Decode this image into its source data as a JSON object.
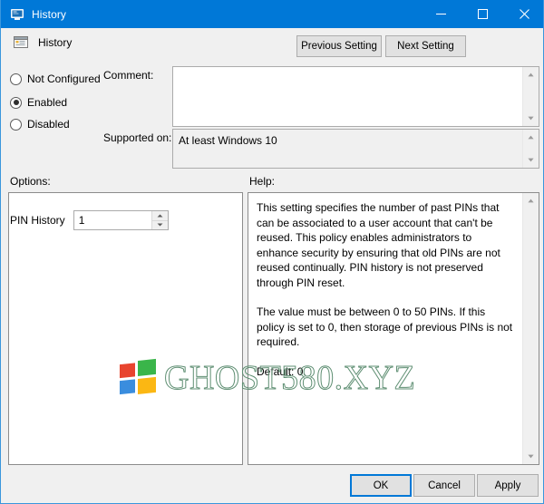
{
  "window": {
    "title": "History",
    "title_icon": "policy-setting-icon",
    "controls": {
      "minimize": "minimize-icon",
      "maximize": "maximize-icon",
      "close": "close-icon"
    }
  },
  "header": {
    "icon": "policy-setting-icon",
    "title": "History"
  },
  "nav": {
    "previous_label": "Previous Setting",
    "next_label": "Next Setting"
  },
  "state": {
    "options": [
      {
        "label": "Not Configured",
        "selected": false
      },
      {
        "label": "Enabled",
        "selected": true
      },
      {
        "label": "Disabled",
        "selected": false
      }
    ]
  },
  "comment": {
    "label": "Comment:",
    "value": "",
    "placeholder": ""
  },
  "supported": {
    "label": "Supported on:",
    "value": "At least Windows 10"
  },
  "options_panel": {
    "label": "Options:",
    "pin_history": {
      "label": "PIN History",
      "value": "1",
      "up_icon": "spinner-up-icon",
      "down_icon": "spinner-down-icon"
    }
  },
  "help_panel": {
    "label": "Help:",
    "paragraphs": [
      "This setting specifies the number of past PINs that can be associated to a user account that can't be reused. This policy enables administrators to enhance security by ensuring that old PINs are not reused continually. PIN history is not preserved through PIN reset.",
      "The value must be between 0 to 50 PINs. If this policy is set to 0, then storage of previous PINs is not required.",
      "Default: 0."
    ]
  },
  "watermark": {
    "text": "GHOST580.XYZ",
    "logo": "windows-logo-icon",
    "logo_colors": {
      "top_left": "#e8442e",
      "top_right": "#3ab54a",
      "bottom_left": "#3a8dde",
      "bottom_right": "#fbb713"
    },
    "text_color": "#5f8f73"
  },
  "footer": {
    "ok_label": "OK",
    "cancel_label": "Cancel",
    "apply_label": "Apply"
  },
  "colors": {
    "titlebar": "#0078d7",
    "accent": "#0078d7",
    "window_bg": "#f0f0f0",
    "field_bg": "#ffffff"
  },
  "scrollbars": {
    "up_icon": "scroll-up-icon",
    "down_icon": "scroll-down-icon"
  }
}
